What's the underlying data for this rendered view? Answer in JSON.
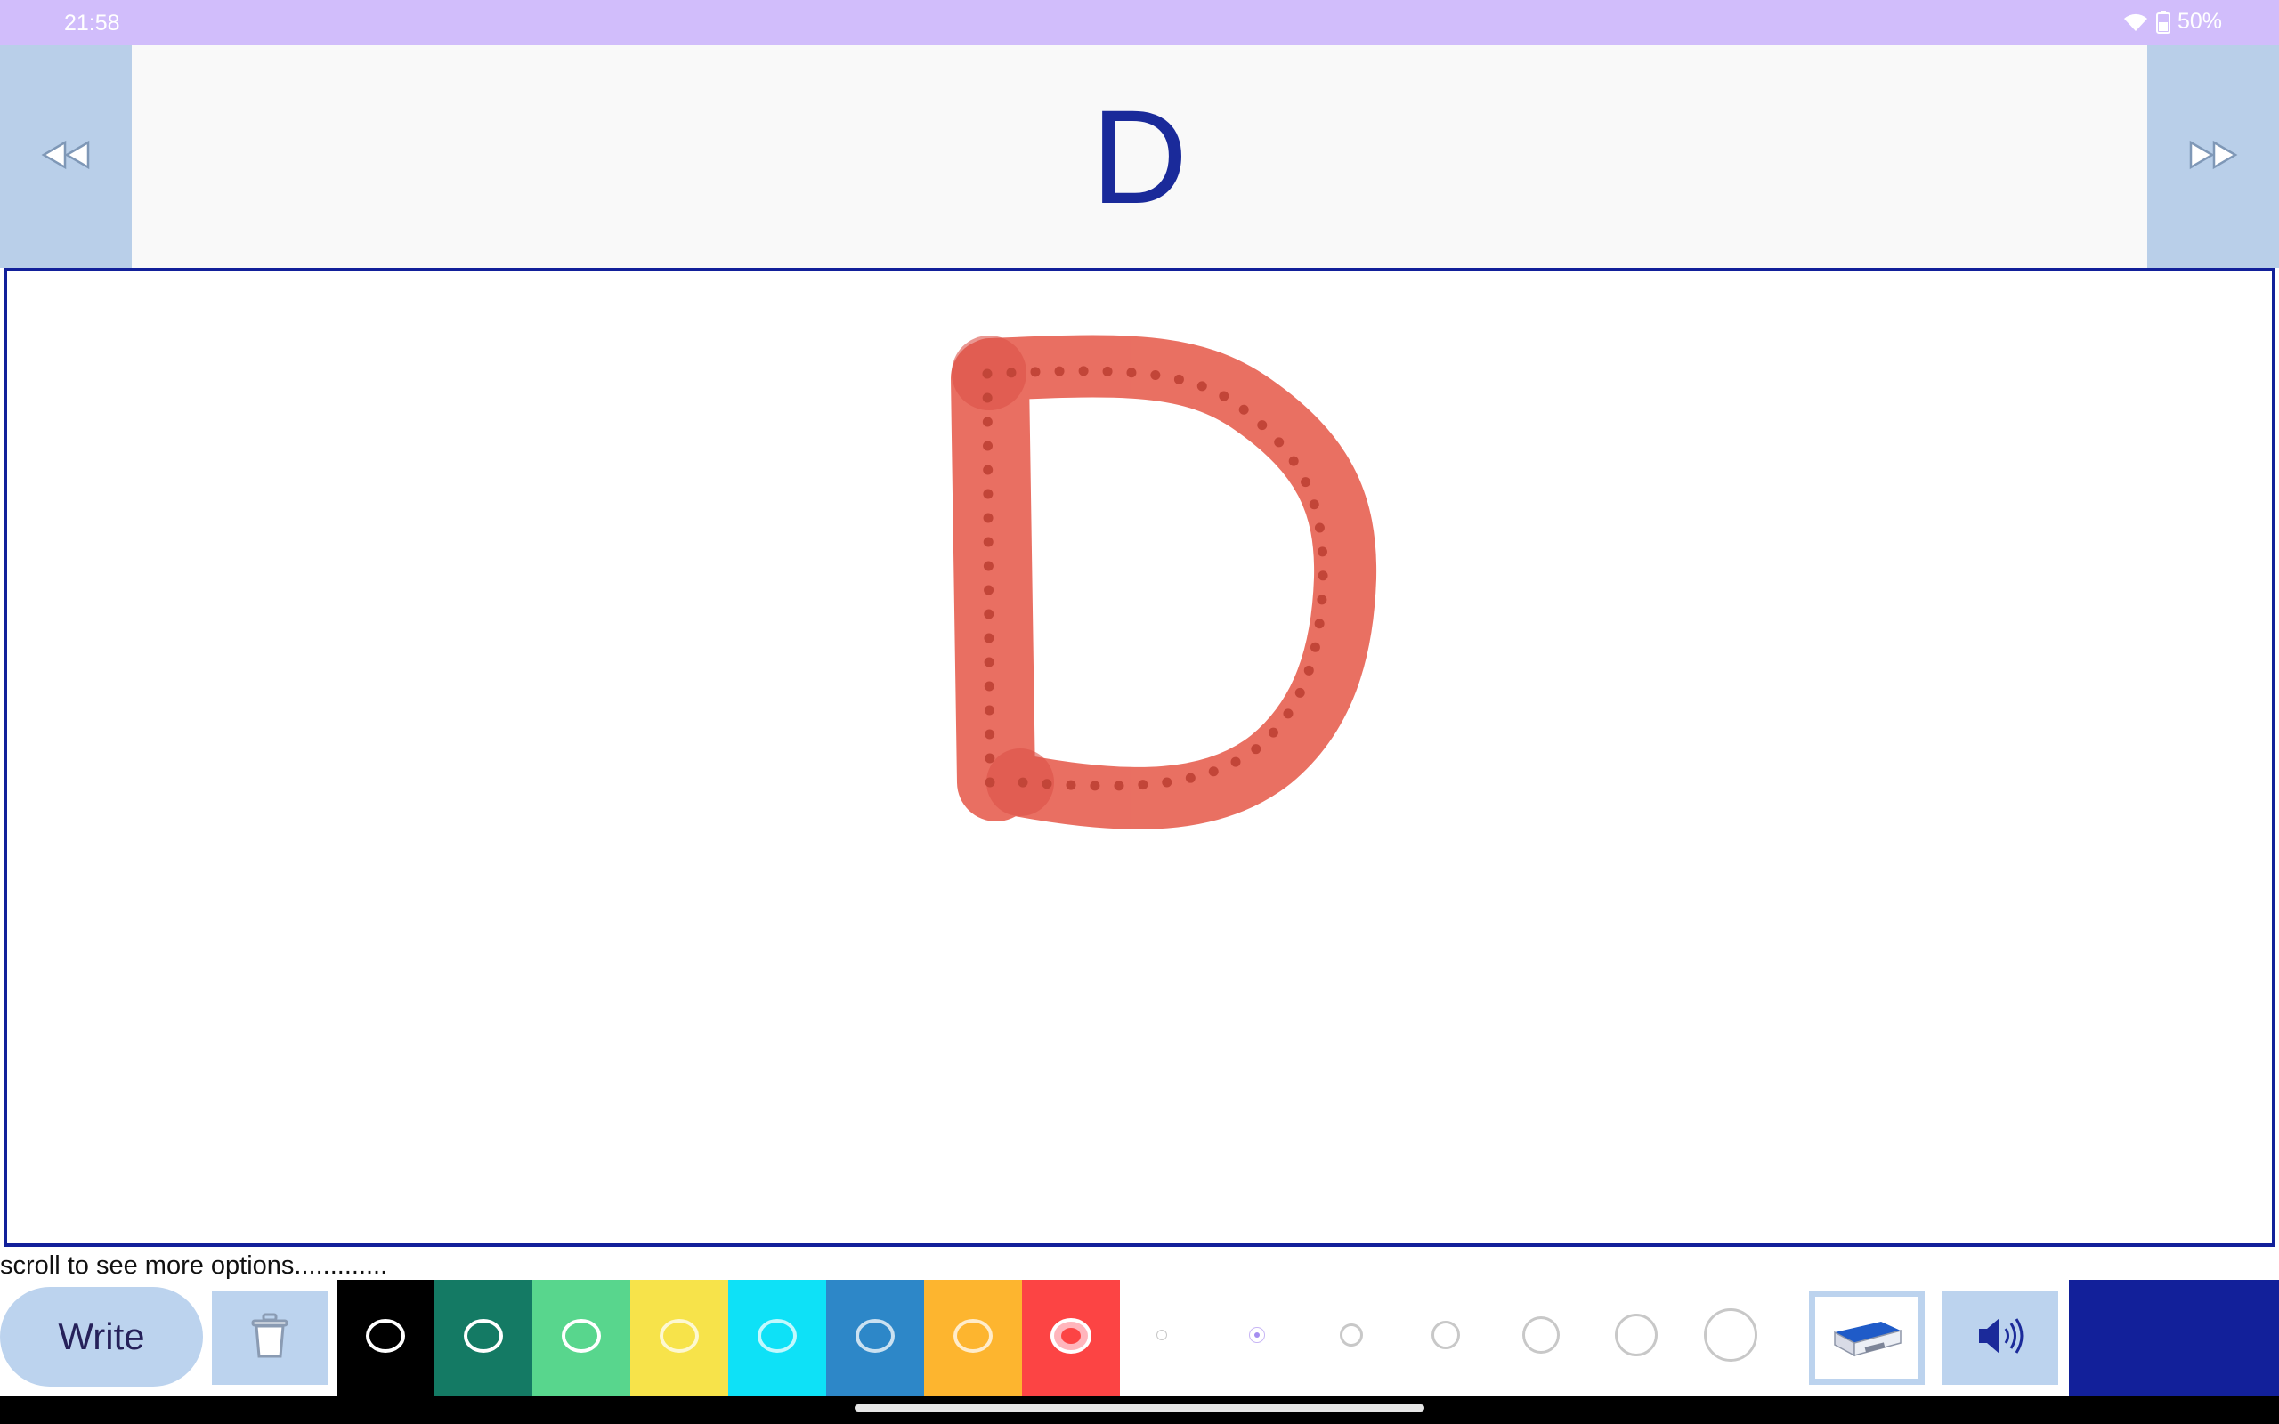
{
  "status_bar": {
    "time": "21:58",
    "battery": "50%"
  },
  "header": {
    "letter": "D"
  },
  "nav": {
    "prev_icon": "rewind-icon",
    "next_icon": "fast-forward-icon"
  },
  "canvas": {
    "trace_letter": "D",
    "trace_color": "#e8685a"
  },
  "hint": {
    "text": "scroll to see more options............."
  },
  "toolbar": {
    "write_label": "Write",
    "trash_icon": "trash-icon",
    "colors": [
      {
        "name": "black",
        "hex": "#000000"
      },
      {
        "name": "dark-green",
        "hex": "#147a64"
      },
      {
        "name": "light-green",
        "hex": "#58d68d"
      },
      {
        "name": "yellow",
        "hex": "#f7e34a"
      },
      {
        "name": "cyan",
        "hex": "#0ee1f7"
      },
      {
        "name": "blue",
        "hex": "#2d87c8"
      },
      {
        "name": "orange",
        "hex": "#fdb52f"
      },
      {
        "name": "red",
        "hex": "#fc4444"
      }
    ],
    "selected_color": "red",
    "brush_sizes": [
      "xs",
      "s",
      "m",
      "l",
      "xl",
      "xxl",
      "xxxl"
    ],
    "selected_size": "s",
    "eraser_icon": "eraser-icon",
    "sound_icon": "speaker-icon"
  }
}
